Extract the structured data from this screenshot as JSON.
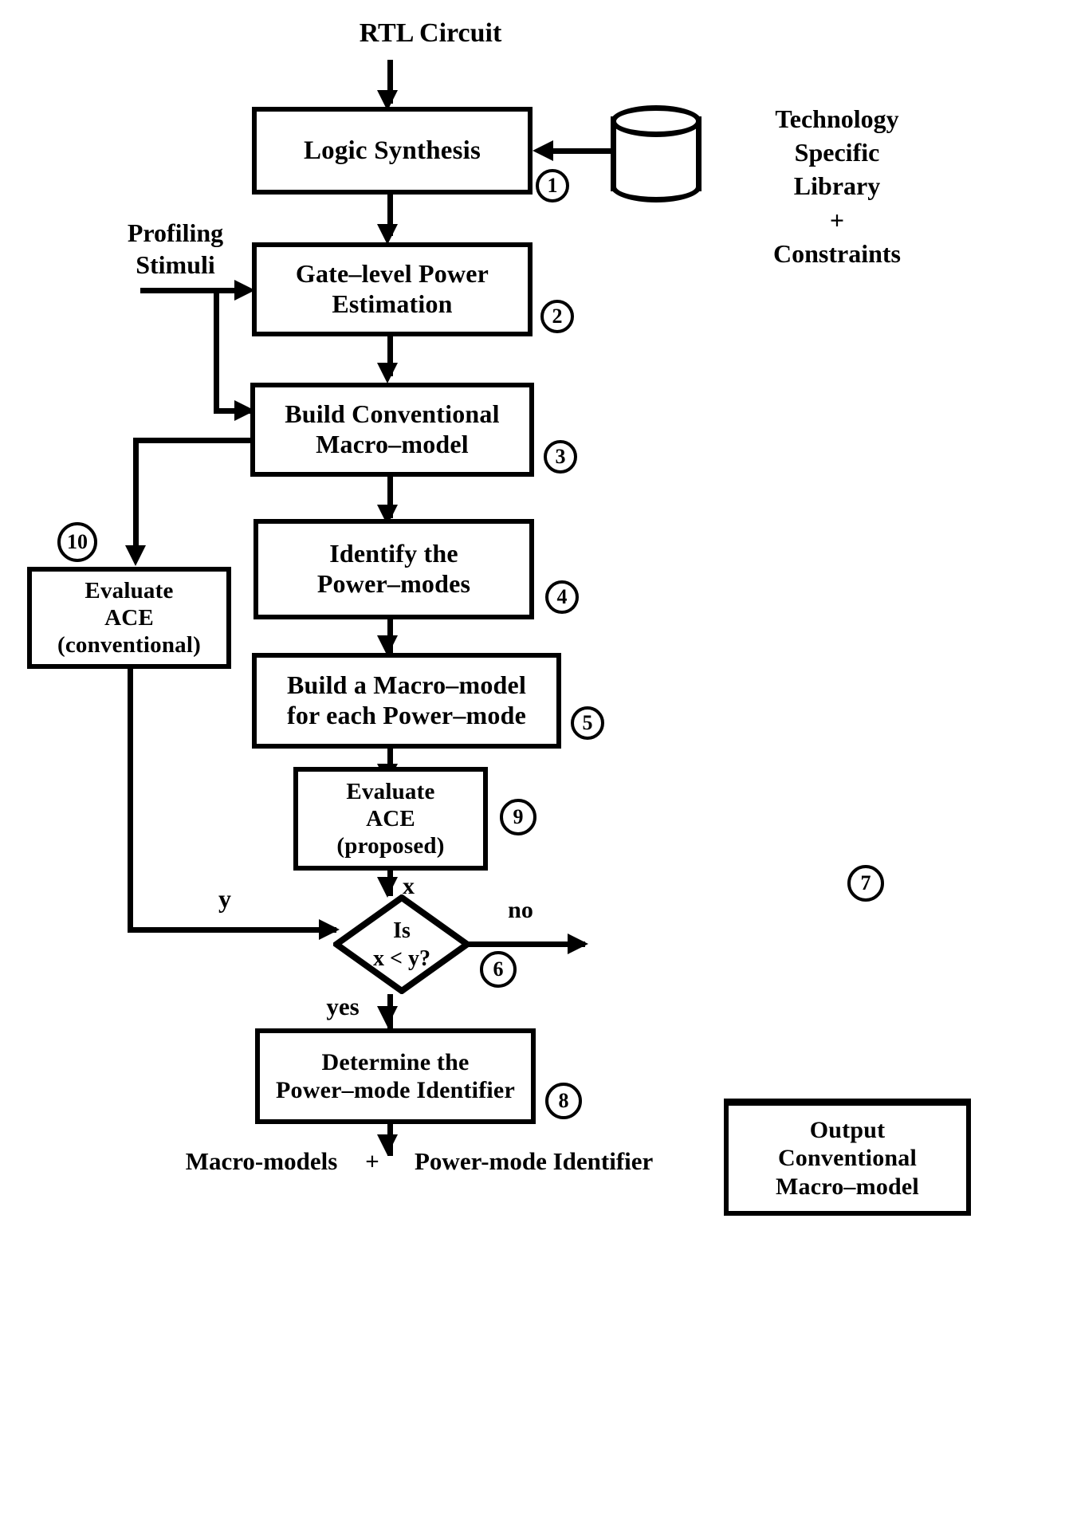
{
  "diagram": {
    "title": "Power macro-modeling methodology flowchart",
    "top_label": "RTL Circuit",
    "bottom_label": {
      "left": "Macro-models",
      "plus": "+",
      "right": "Power-mode Identifier"
    },
    "side_inputs": {
      "profiling": {
        "line1": "Profiling",
        "line2": "Stimuli"
      },
      "library": {
        "line1": "Technology",
        "line2": "Specific",
        "line3": "Library",
        "line4": "+",
        "line5": "Constraints"
      }
    },
    "boxes": [
      {
        "id": "logic-synthesis",
        "lines": [
          "Logic  Synthesis"
        ],
        "step": "1"
      },
      {
        "id": "gate-level-power-estimation",
        "lines": [
          "Gate–level Power",
          "Estimation"
        ],
        "step": "2"
      },
      {
        "id": "build-conventional-macro-model",
        "lines": [
          "Build  Conventional",
          "Macro–model"
        ],
        "step": "3"
      },
      {
        "id": "identify-power-modes",
        "lines": [
          "Identify the",
          "Power–modes"
        ],
        "step": "4"
      },
      {
        "id": "build-macro-model-per-power-mode",
        "lines": [
          "Build a Macro–model",
          "for each Power–mode"
        ],
        "step": "5"
      },
      {
        "id": "evaluate-ace-proposed",
        "lines": [
          "Evaluate",
          "ACE",
          "(proposed)"
        ],
        "step": "9"
      },
      {
        "id": "evaluate-ace-conventional",
        "lines": [
          "Evaluate",
          "ACE",
          "(conventional)"
        ],
        "step": "10"
      },
      {
        "id": "output-conventional-macro-model",
        "lines": [
          "Output",
          "Conventional",
          "Macro–model"
        ],
        "step": "7"
      },
      {
        "id": "determine-power-mode-identifier",
        "lines": [
          "Determine the",
          "Power–mode Identifier"
        ],
        "step": "8"
      }
    ],
    "decision": {
      "id": "is-x-less-than-y",
      "line1": "Is",
      "line2": "x < y?",
      "step": "6"
    },
    "edge_labels": {
      "x": "x",
      "y": "y",
      "no": "no",
      "yes": "yes"
    },
    "colors": {
      "ink": "#000000",
      "paper": "#ffffff"
    }
  }
}
